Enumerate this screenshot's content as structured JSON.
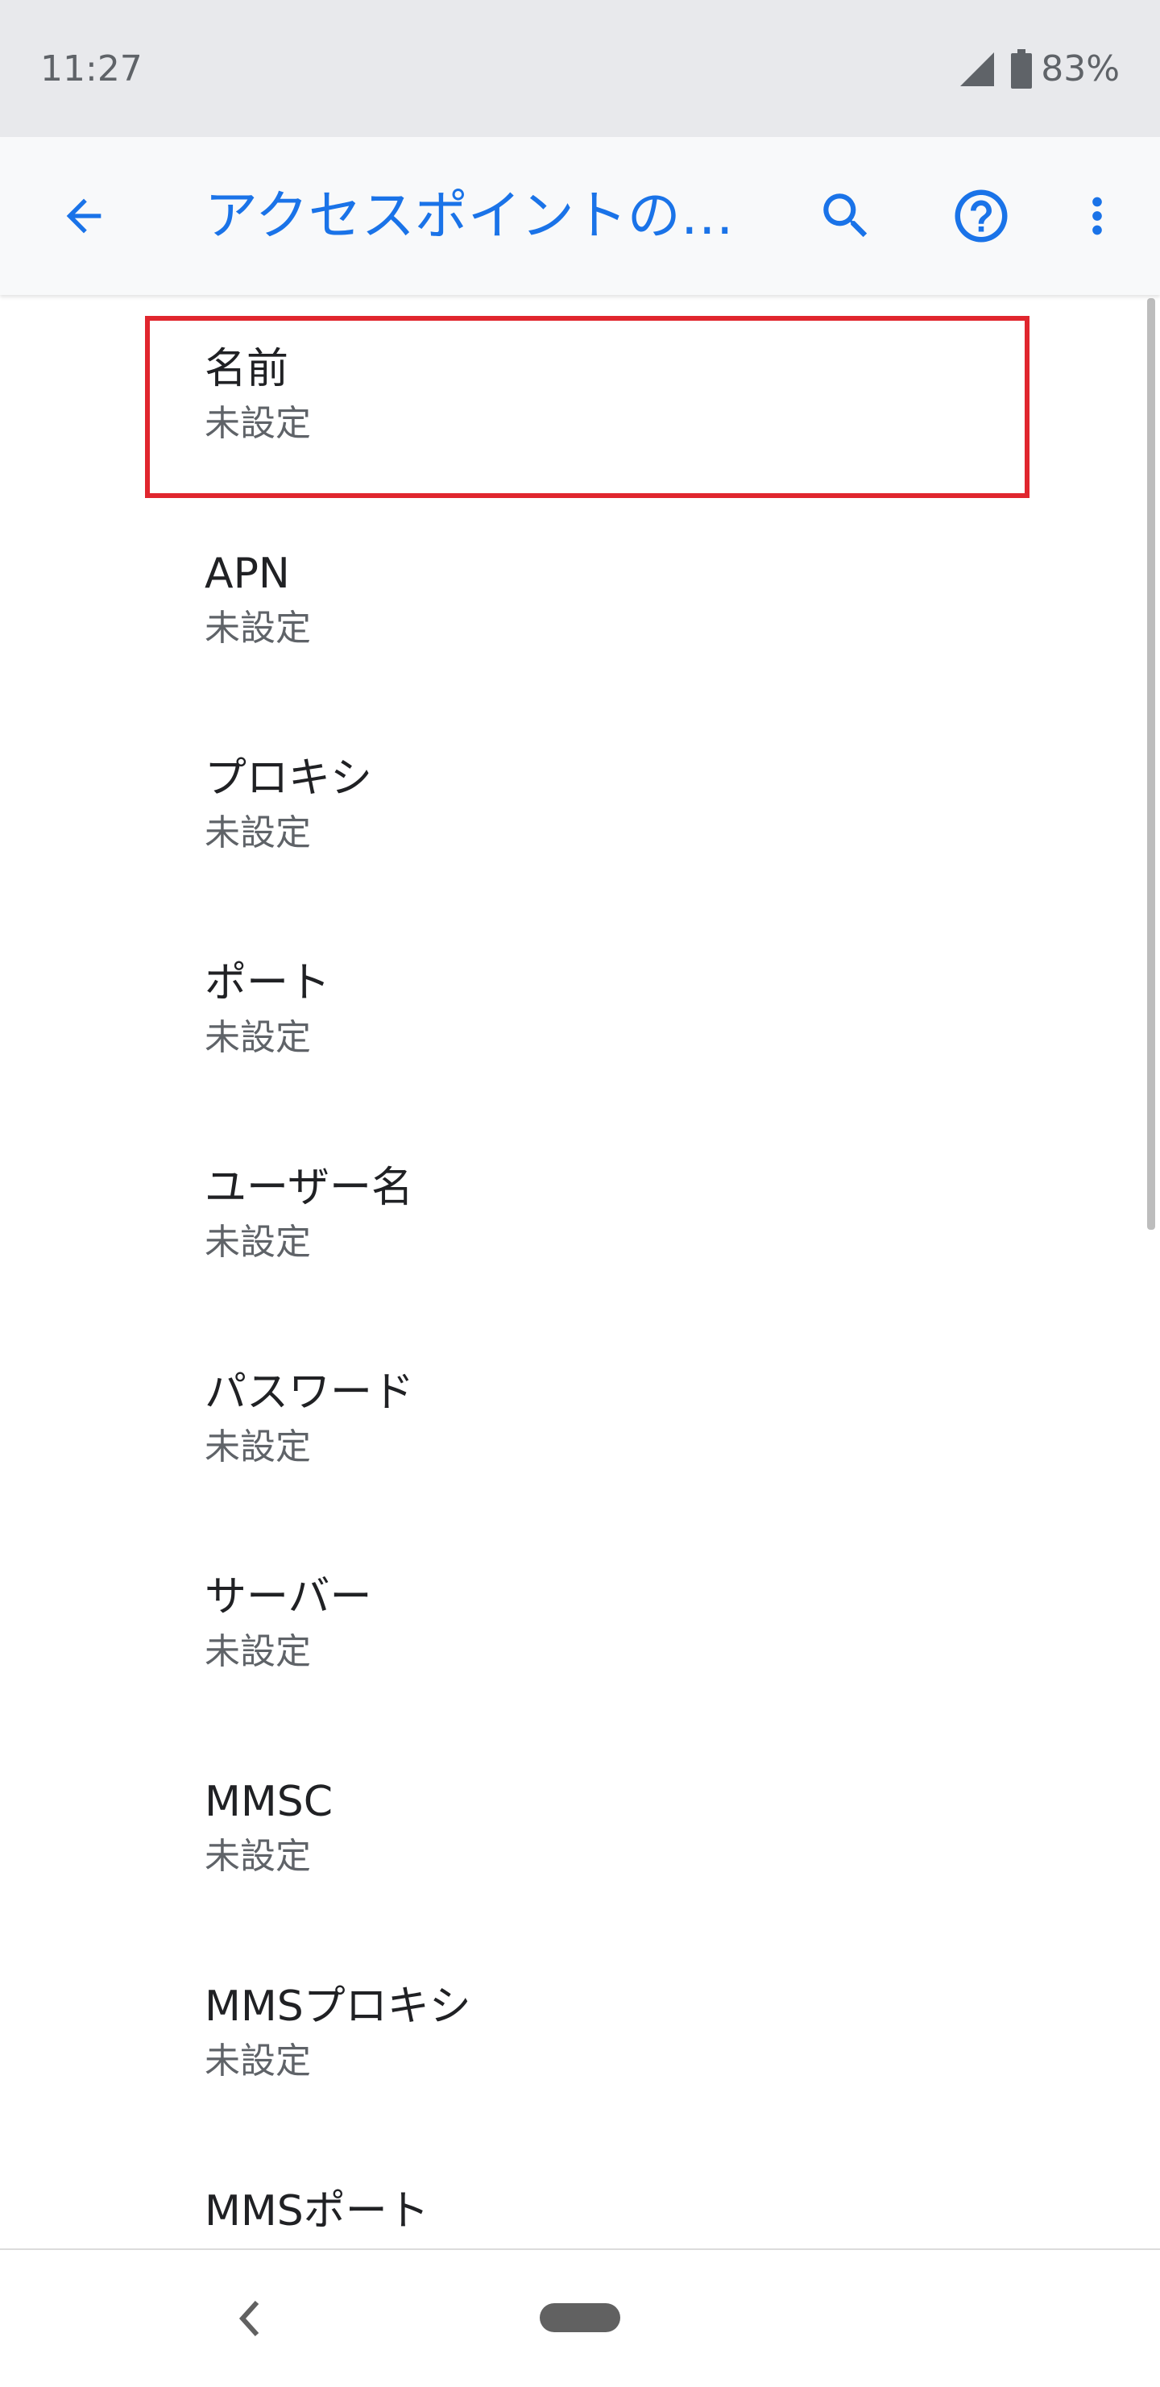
{
  "status_bar": {
    "time": "11:27",
    "battery": "83%"
  },
  "app_bar": {
    "title": "アクセスポイントの…",
    "icons": [
      "back-arrow-icon",
      "search-icon",
      "help-icon",
      "more-vert-icon"
    ],
    "accent_color": "#1a73e8"
  },
  "list": {
    "items": [
      {
        "title": "名前",
        "summary": "未設定"
      },
      {
        "title": "APN",
        "summary": "未設定"
      },
      {
        "title": "プロキシ",
        "summary": "未設定"
      },
      {
        "title": "ポート",
        "summary": "未設定"
      },
      {
        "title": "ユーザー名",
        "summary": "未設定"
      },
      {
        "title": "パスワード",
        "summary": "未設定"
      },
      {
        "title": "サーバー",
        "summary": "未設定"
      },
      {
        "title": "MMSC",
        "summary": "未設定"
      },
      {
        "title": "MMSプロキシ",
        "summary": "未設定"
      },
      {
        "title": "MMSポート",
        "summary": ""
      }
    ]
  },
  "highlight_color": "#e0262e",
  "nav_bar": {
    "icons": [
      "nav-back-icon",
      "home-pill-icon"
    ]
  }
}
